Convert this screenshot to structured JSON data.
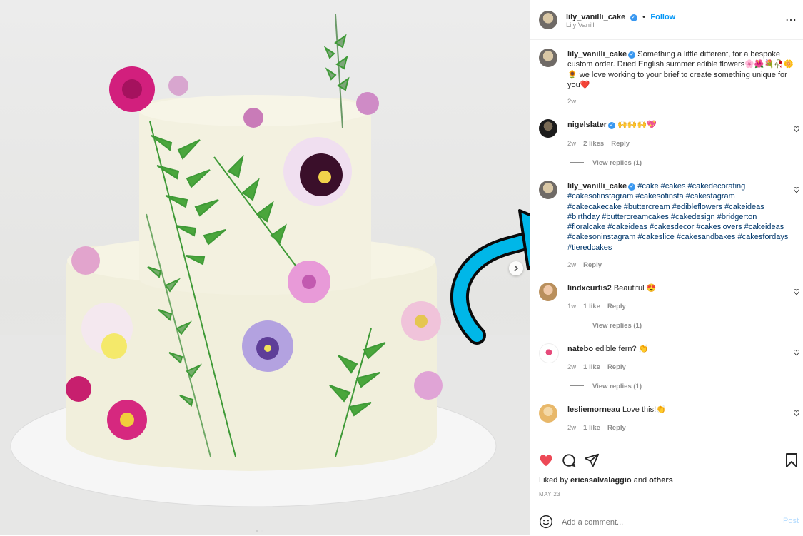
{
  "header": {
    "username": "lily_vanilli_cake",
    "follow": "Follow",
    "subtitle": "Lily Vanilli",
    "more_icon": "more-icon"
  },
  "caption": {
    "username": "lily_vanilli_cake",
    "text": "Something a little different, for a bespoke custom order. Dried English summer edible flowers🌸🌺💐🥀🌼🌻 we love working to your brief to create something unique for you❤️",
    "time": "2w"
  },
  "comments": [
    {
      "username": "nigelslater",
      "text": "🙌🙌🙌💖",
      "time": "2w",
      "likes": "2 likes",
      "reply": "Reply",
      "view_replies": "View replies (1)"
    },
    {
      "username": "lily_vanilli_cake",
      "text": "#cake #cakes #cakedecorating #cakesofinstagram #cakesofinsta #cakestagram #cakecakecake #buttercream #edibleflowers #cakeideas #birthday #buttercreamcakes #cakedesign #bridgerton #floralcake #cakeideas #cakesdecor #cakeslovers #cakeideas #cakesoninstagram #cakeslice #cakesandbakes #cakesfordays #tieredcakes",
      "time": "2w",
      "reply": "Reply"
    },
    {
      "username": "lindxcurtis2",
      "text": "Beautiful 😍",
      "time": "1w",
      "likes": "1 like",
      "reply": "Reply",
      "view_replies": "View replies (1)"
    },
    {
      "username": "natebo",
      "text": "edible fern? 👏",
      "time": "2w",
      "likes": "1 like",
      "reply": "Reply",
      "view_replies": "View replies (1)"
    },
    {
      "username": "lesliemorneau",
      "text": "Love this!👏",
      "time": "2w",
      "likes": "1 like",
      "reply": "Reply"
    }
  ],
  "actions": {
    "liked_by_prefix": "Liked by",
    "liked_by_user": "ericasalvalaggio",
    "liked_by_and": "and",
    "liked_by_others": "others",
    "date": "MAY 23"
  },
  "comment_box": {
    "placeholder": "Add a comment...",
    "post": "Post"
  },
  "colors": {
    "accent_blue": "#0095f6",
    "like_red": "#ed4956",
    "arrow_cyan": "#00b7e8",
    "hashtag": "#00376b"
  }
}
